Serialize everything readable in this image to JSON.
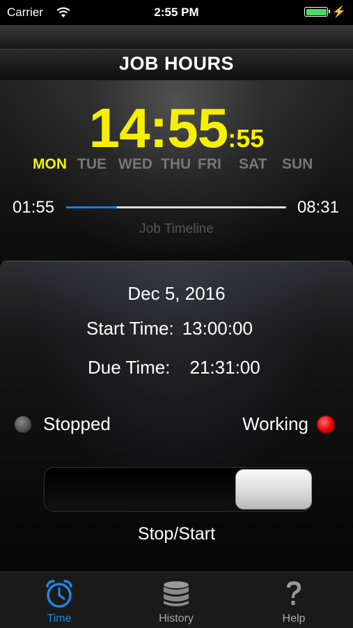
{
  "status_bar": {
    "carrier": "Carrier",
    "time": "2:55 PM",
    "battery_icon": "battery-full-icon",
    "charging_glyph": "⚡"
  },
  "header": {
    "title": "JOB HOURS"
  },
  "clock": {
    "hours_minutes": "14:55",
    "seconds": ":55",
    "color": "#f5f000"
  },
  "days": [
    {
      "label": "MON",
      "active": true
    },
    {
      "label": "TUE",
      "active": false
    },
    {
      "label": "WED",
      "active": false
    },
    {
      "label": "THU",
      "active": false
    },
    {
      "label": "FRI",
      "active": false
    },
    {
      "label": "SAT",
      "active": false
    },
    {
      "label": "SUN",
      "active": false
    }
  ],
  "timeline": {
    "start": "01:55",
    "end": "08:31",
    "label": "Job Timeline",
    "progress": 0.23,
    "accent": "#1e7bd8"
  },
  "job": {
    "date": "Dec 5, 2016",
    "start_label": "Start Time:",
    "start_value": "13:00:00",
    "due_label": "Due Time:",
    "due_value": "21:31:00"
  },
  "status": {
    "stopped_label": "Stopped",
    "working_label": "Working",
    "indicator_color": "#ff0000"
  },
  "toggle": {
    "label": "Stop/Start",
    "state": "on"
  },
  "tabs": [
    {
      "label": "Time",
      "icon": "alarm-clock-icon",
      "active": true
    },
    {
      "label": "History",
      "icon": "database-stack-icon",
      "active": false
    },
    {
      "label": "Help",
      "icon": "question-mark-icon",
      "active": false
    }
  ]
}
